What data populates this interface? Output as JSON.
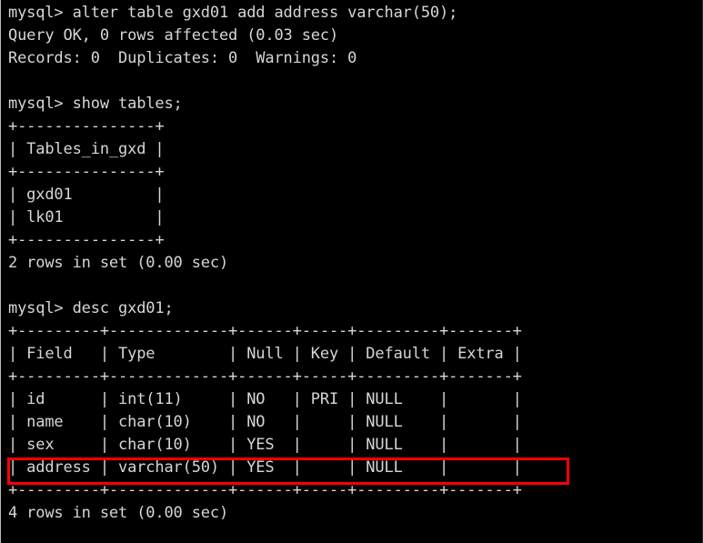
{
  "terminal": {
    "app": "mysql-client",
    "prompt": "mysql>",
    "foreground_color": "#d6d6d6",
    "background_color": "#000000",
    "highlight_color": "#ff0000",
    "lines": [
      "mysql> alter table gxd01 add address varchar(50);",
      "Query OK, 0 rows affected (0.03 sec)",
      "Records: 0  Duplicates: 0  Warnings: 0",
      "",
      "mysql> show tables;",
      "+---------------+",
      "| Tables_in_gxd |",
      "+---------------+",
      "| gxd01         |",
      "| lk01          |",
      "+---------------+",
      "2 rows in set (0.00 sec)",
      "",
      "mysql> desc gxd01;",
      "+---------+-------------+------+-----+---------+-------+",
      "| Field   | Type        | Null | Key | Default | Extra |",
      "+---------+-------------+------+-----+---------+-------+",
      "| id      | int(11)     | NO   | PRI | NULL    |       |",
      "| name    | char(10)    | NO   |     | NULL    |       |",
      "| sex     | char(10)    | YES  |     | NULL    |       |",
      "| address | varchar(50) | YES  |     | NULL    |       |",
      "+---------+-------------+------+-----+---------+-------+",
      "4 rows in set (0.00 sec)"
    ],
    "commands": [
      "alter table gxd01 add address varchar(50);",
      "show tables;",
      "desc gxd01;"
    ],
    "statuses": [
      "Query OK, 0 rows affected (0.03 sec)",
      "Records: 0  Duplicates: 0  Warnings: 0",
      "2 rows in set (0.00 sec)",
      "4 rows in set (0.00 sec)"
    ],
    "tables_result": {
      "header": "Tables_in_gxd",
      "rows": [
        "gxd01",
        "lk01"
      ],
      "row_count": 2,
      "duration": "0.00 sec"
    },
    "desc_result": {
      "columns": [
        "Field",
        "Type",
        "Null",
        "Key",
        "Default",
        "Extra"
      ],
      "rows": [
        [
          "id",
          "int(11)",
          "NO",
          "PRI",
          "NULL",
          ""
        ],
        [
          "name",
          "char(10)",
          "NO",
          "",
          "NULL",
          ""
        ],
        [
          "sex",
          "char(10)",
          "YES",
          "",
          "NULL",
          ""
        ],
        [
          "address",
          "varchar(50)",
          "YES",
          "",
          "NULL",
          ""
        ]
      ],
      "row_count": 4,
      "duration": "0.00 sec",
      "highlighted_row": "address"
    }
  }
}
